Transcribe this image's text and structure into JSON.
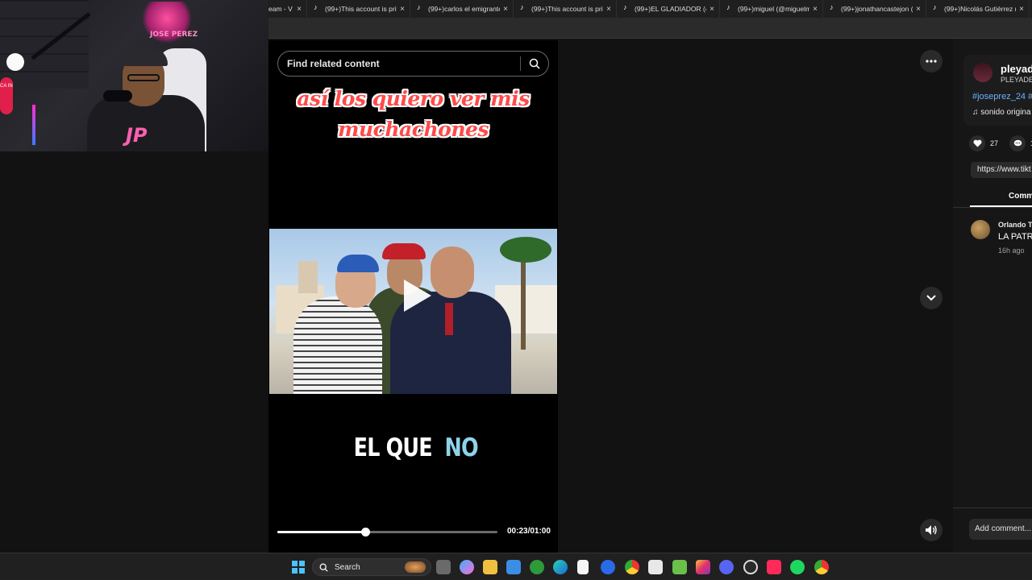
{
  "browser": {
    "tabs": [
      {
        "title": "eam - V",
        "first": true
      },
      {
        "title": "(99+)This account is priv"
      },
      {
        "title": "(99+)carlos el emigrante"
      },
      {
        "title": "(99+)This account is priv"
      },
      {
        "title": "(99+)EL GLADIADOR (@"
      },
      {
        "title": "(99+)miguel (@miguelm"
      },
      {
        "title": "(99+)jonathancastejon ("
      },
      {
        "title": "(99+)Nicolás Gutiérrez ("
      }
    ],
    "close_glyph": "×"
  },
  "webcam": {
    "logo_text": "JOSE PEREZ",
    "shirt_text": "JP",
    "lamp_text": "CA IN"
  },
  "player": {
    "search_placeholder": "Find related content",
    "caption_top_line1": "así los quiero ver mis",
    "caption_top_line2": "muchachones",
    "caption_bottom_white": "EL QUE ",
    "caption_bottom_blue": "NO",
    "time": "00:23/01:00",
    "progress": 0.4,
    "colors": {
      "caption_top": "#ff4a4a",
      "caption_bottom_blue": "#8fd3ea"
    }
  },
  "sidebar": {
    "username": "pleyad",
    "handle": "PLEYADE",
    "hashtags": "#joseprez_24 #",
    "sound": "sonido origina",
    "likes": "27",
    "comments_count": "1",
    "url": "https://www.tikt",
    "comments_tab": "Comm",
    "comment": {
      "author": "Orlando T",
      "text": "LA PATR",
      "time": "16h ago"
    },
    "add_comment_placeholder": "Add comment..."
  },
  "taskbar": {
    "search_label": "Search"
  },
  "icons": {
    "more": "more-horizontal-icon",
    "down": "chevron-down-icon",
    "volume": "volume-icon",
    "search": "search-icon",
    "heart": "heart-icon",
    "comment": "comment-icon",
    "music": "music-note-icon"
  }
}
